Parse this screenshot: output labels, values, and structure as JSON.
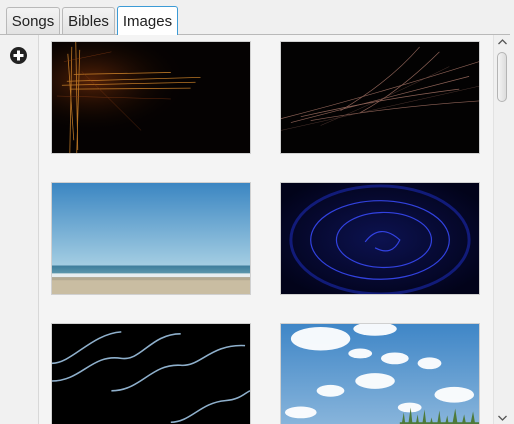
{
  "tabs": [
    {
      "label": "Songs",
      "active": false
    },
    {
      "label": "Bibles",
      "active": false
    },
    {
      "label": "Images",
      "active": true
    }
  ],
  "sidebar": {
    "add_icon": "plus-circle-icon"
  },
  "images": [
    {
      "subject": "glowing-cross-dark"
    },
    {
      "subject": "light-streaks-dark"
    },
    {
      "subject": "beach-ocean-sky"
    },
    {
      "subject": "blue-swirl-dark"
    },
    {
      "subject": "light-waves-dark"
    },
    {
      "subject": "clouds-sky-grass"
    }
  ],
  "colors": {
    "active_tab_border": "#3c9bd6",
    "panel_background": "#f4f4f4"
  }
}
